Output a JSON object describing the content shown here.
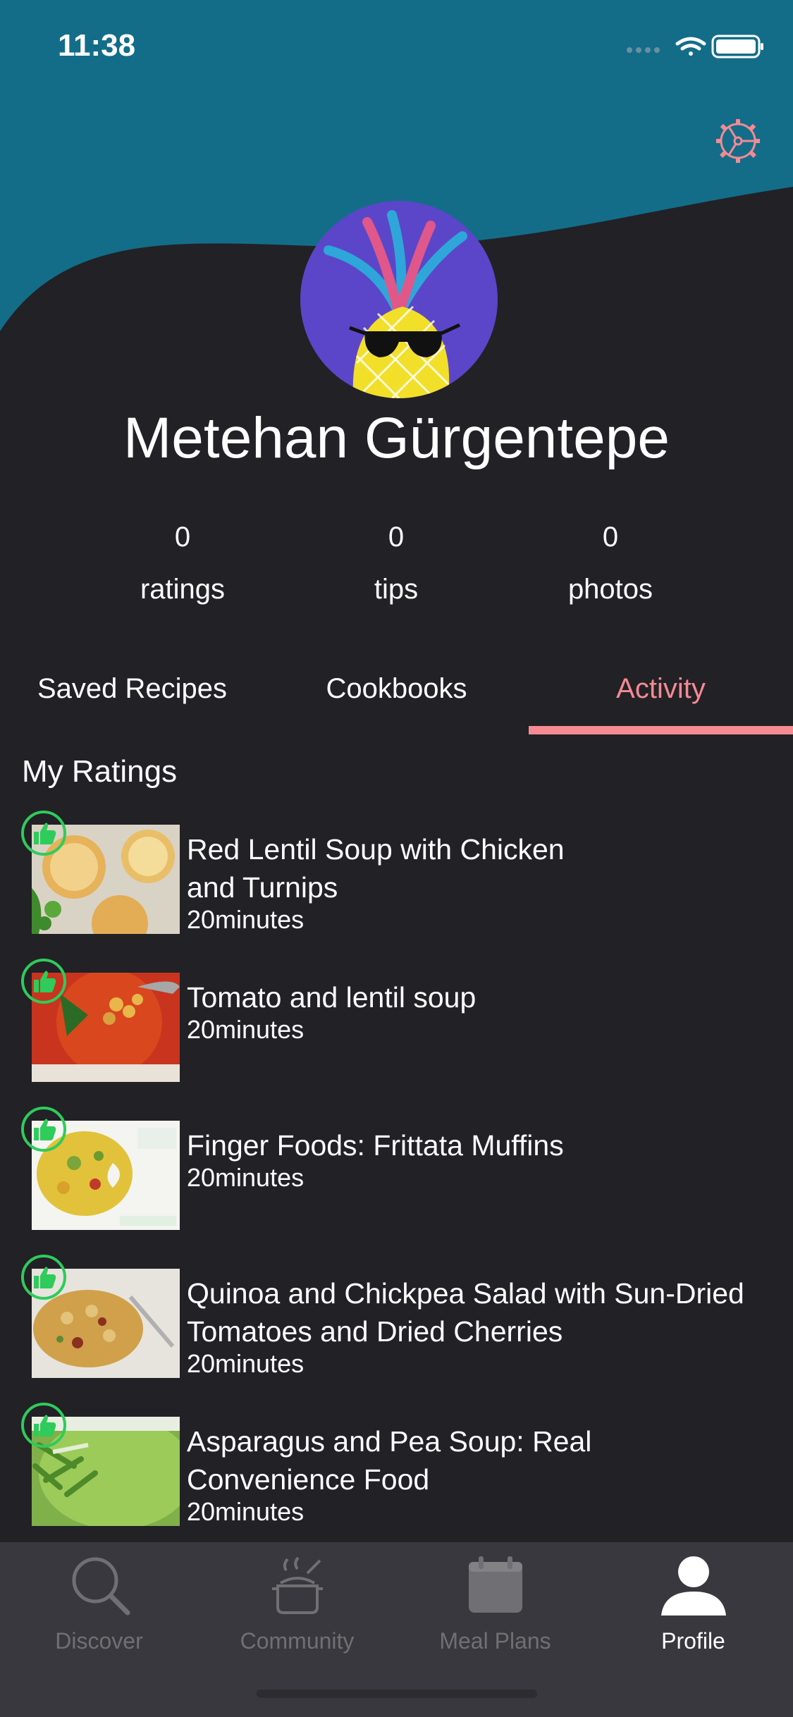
{
  "status_bar": {
    "time": "11:38"
  },
  "profile": {
    "name": "Metehan Gürgentepe",
    "stats": [
      {
        "value": "0",
        "label": "ratings"
      },
      {
        "value": "0",
        "label": "tips"
      },
      {
        "value": "0",
        "label": "photos"
      }
    ]
  },
  "tabs": [
    {
      "label": "Saved Recipes",
      "active": false
    },
    {
      "label": "Cookbooks",
      "active": false
    },
    {
      "label": "Activity",
      "active": true
    }
  ],
  "section": {
    "title": "My Ratings"
  },
  "ratings": [
    {
      "title": "Red Lentil Soup with Chicken and Turnips",
      "time": "20minutes",
      "thumb_icon": "lentil-soup-photo",
      "badge_icon": "thumbs-up-icon"
    },
    {
      "title": "Tomato and lentil soup",
      "time": "20minutes",
      "thumb_icon": "tomato-soup-photo",
      "badge_icon": "thumbs-up-icon"
    },
    {
      "title": "Finger Foods: Frittata Muffins",
      "time": "20minutes",
      "thumb_icon": "frittata-muffins-photo",
      "badge_icon": "thumbs-up-icon"
    },
    {
      "title": "Quinoa and Chickpea Salad with Sun-Dried Tomatoes and Dried Cherries",
      "time": "20minutes",
      "thumb_icon": "quinoa-salad-photo",
      "badge_icon": "thumbs-up-icon"
    },
    {
      "title": "Asparagus and Pea Soup: Real Convenience Food",
      "time": "20minutes",
      "thumb_icon": "asparagus-soup-photo",
      "badge_icon": "thumbs-up-icon"
    }
  ],
  "tab_bar": [
    {
      "label": "Discover",
      "icon": "search-icon",
      "active": false
    },
    {
      "label": "Community",
      "icon": "cooking-pot-icon",
      "active": false
    },
    {
      "label": "Meal Plans",
      "icon": "calendar-icon",
      "active": false
    },
    {
      "label": "Profile",
      "icon": "person-icon",
      "active": true
    }
  ],
  "colors": {
    "header": "#136d89",
    "background": "#222126",
    "accent": "#f58a92",
    "badge": "#2fcb5b",
    "tab_bar": "#38383e"
  }
}
